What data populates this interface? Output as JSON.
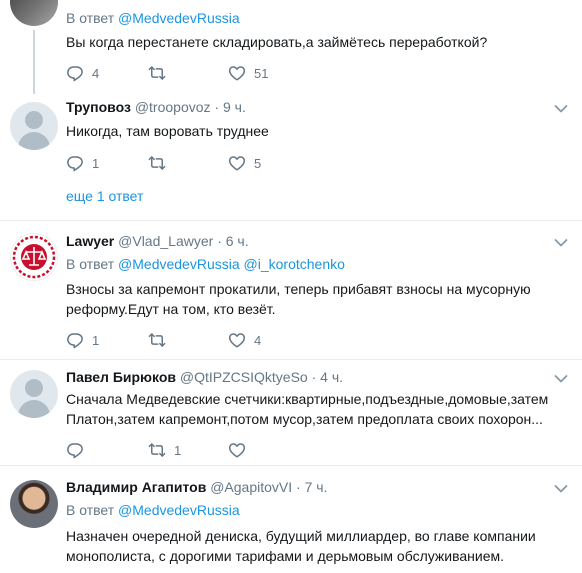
{
  "tweets": [
    {
      "reply_prefix": "В ответ",
      "mentions": [
        "@MedvedevRussia"
      ],
      "text": "Вы когда перестанете складировать,а займётесь переработкой?",
      "replies": "4",
      "retweets": "",
      "likes": "51"
    },
    {
      "name": "Труповоз",
      "handle": "@troopovoz",
      "time": "9 ч.",
      "text": "Никогда, там воровать труднее",
      "replies": "1",
      "retweets": "",
      "likes": "5",
      "more_replies": "еще 1 ответ"
    },
    {
      "name": "Lawyer",
      "handle": "@Vlad_Lawyer",
      "time": "6 ч.",
      "reply_prefix": "В ответ",
      "mentions": [
        "@MedvedevRussia",
        "@i_korotchenko"
      ],
      "text_lines": [
        "Взносы за капремонт прокатили, теперь прибавят взносы на мусорную",
        "реформу.Едут на том, кто везёт."
      ],
      "replies": "1",
      "retweets": "",
      "likes": "4"
    },
    {
      "name": "Павел Бирюков",
      "handle": "@QtIPZCSIQktyeSo",
      "time": "4 ч.",
      "text_lines": [
        "Сначала Медведевские счетчики:квартирные,подъездные,домовые,затем",
        "Платон,затем капремонт,потом мусор,затем предоплата своих похорон..."
      ],
      "replies": "",
      "retweets": "1",
      "likes": ""
    },
    {
      "name": "Владимир Агапитов",
      "handle": "@AgapitovVI",
      "time": "7 ч.",
      "reply_prefix": "В ответ",
      "mentions": [
        "@MedvedevRussia"
      ],
      "text_lines": [
        "Назначен очередной дениска, будущий миллиардер, во главе компании",
        "монополиста, с дорогими тарифами и дерьмовым обслуживанием."
      ]
    }
  ],
  "separator": "·",
  "colors": {
    "link": "#1b95e0",
    "muted": "#657786",
    "divider": "#e6ecf0",
    "text": "#14171a"
  },
  "icons": [
    "reply-icon",
    "retweet-icon",
    "like-icon",
    "caret-down-icon",
    "avatar-default",
    "avatar-lawyer-logo",
    "avatar-photo"
  ]
}
